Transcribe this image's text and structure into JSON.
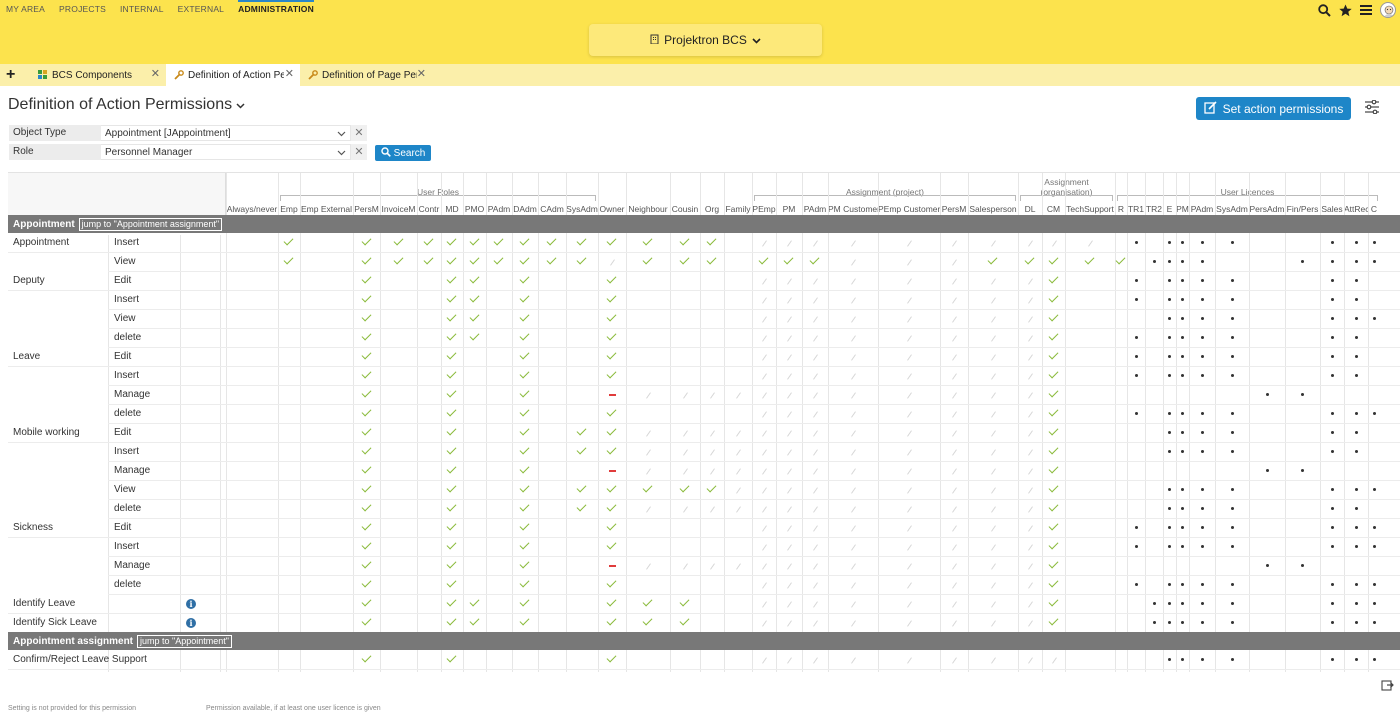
{
  "topnav": [
    {
      "label": "MY AREA",
      "active": false
    },
    {
      "label": "PROJECTS",
      "active": false
    },
    {
      "label": "INTERNAL",
      "active": false
    },
    {
      "label": "EXTERNAL",
      "active": false
    },
    {
      "label": "ADMINISTRATION",
      "active": true
    }
  ],
  "project_selector": {
    "label": "Projektron BCS"
  },
  "tabs": [
    {
      "label": "BCS Components",
      "active": false,
      "icon": "components-icon"
    },
    {
      "label": "Definition of Action Per",
      "active": true,
      "icon": "wrench-icon"
    },
    {
      "label": "Definition of Page Perm",
      "active": false,
      "icon": "wrench-icon"
    }
  ],
  "page": {
    "title": "Definition of Action Permissions"
  },
  "set_button": {
    "label": "Set action permissions"
  },
  "filters": {
    "object_type": {
      "label": "Object Type",
      "value": "Appointment [JAppointment]"
    },
    "role": {
      "label": "Role",
      "value": "Personnel Manager"
    },
    "search_label": "Search"
  },
  "colors": {
    "accent": "#1e86c8",
    "topbar": "#fce34d",
    "tabsbar": "#fbefaa",
    "check": "#8aba3a",
    "deny": "#e03c3c",
    "section": "#787878"
  },
  "grid": {
    "groups": [
      {
        "label": "User Roles",
        "from": 1,
        "to": 12
      },
      {
        "label": "Assignment (project)",
        "from": 16,
        "to": 25
      },
      {
        "label": "Assignment\n(organisation)",
        "from": 26,
        "to": 28
      },
      {
        "label": "User Licences",
        "from": 29,
        "to": 44
      }
    ],
    "columns": [
      "Always/never",
      "Emp",
      "Emp External",
      "PersM",
      "InvoiceM",
      "Contr",
      "MD",
      "PMO",
      "PAdm",
      "DAdm",
      "CAdm",
      "SysAdm",
      "Owner",
      "Neighbour",
      "Cousin",
      "Org",
      "Family",
      "PEmp",
      "PM",
      "PAdm",
      "PM Customer",
      "PEmp Customer",
      "PersM",
      "Salesperson",
      "DL",
      "CM",
      "TechSupport",
      "R",
      "TR1",
      "TR2",
      "E",
      "PM",
      "PAdm",
      "SysAdm",
      "PersAdm",
      "Fin/Pers",
      "Sales",
      "AttRec",
      "C"
    ],
    "sections": [
      {
        "title": "Appointment",
        "jump": "jump to \"Appointment assignment\"",
        "rows": [
          {
            "object": "Appointment",
            "action": "Insert",
            "cells": ".k.kkkkkkkkkkkkk.nnnnnnnnnn.*.****..*****"
          },
          {
            "object": "",
            "action": "View",
            "cells": ".k.kkkkkkkkknkkk.kkknnnkkkkk.****..*****"
          },
          {
            "object": "Deputy",
            "action": "Edit",
            "cells": "...k..kk.k..k....nnnnnnnnk..*.****..**.*."
          },
          {
            "object": "",
            "action": "Insert",
            "cells": "...k..kk.k..k....nnnnnnnnk..*.****..**.*."
          },
          {
            "object": "",
            "action": "View",
            "cells": "...k..kk.k..k....nnnnnnnnk....****..****."
          },
          {
            "object": "",
            "action": "delete",
            "cells": "...k..kk.k..k....nnnnnnnnk..*.****..**.*."
          },
          {
            "object": "Leave",
            "action": "Edit",
            "cells": "...k..k..k..k....nnnnnnnnk..*.****..**.*."
          },
          {
            "object": "",
            "action": "Insert",
            "cells": "...k..k..k..k....nnnnnnnnk..*.****..**.*."
          },
          {
            "object": "",
            "action": "Manage",
            "cells": "...k..k..k..-nnnnnnnnnnnnk........**...."
          },
          {
            "object": "",
            "action": "delete",
            "cells": "...k..k..k..k....nnnnnnnnk..*.****..****."
          },
          {
            "object": "Mobile working",
            "action": "Edit",
            "cells": "...k..k..k.kknnnnnnnnnnnnk....****..**.*."
          },
          {
            "object": "",
            "action": "Insert",
            "cells": "...k..k..k.kknnnnnnnnnnnnk....****..**.*."
          },
          {
            "object": "",
            "action": "Manage",
            "cells": "...k..k..k..-nnnnnnnnnnnnk........**...."
          },
          {
            "object": "",
            "action": "View",
            "cells": "...k..k..k.kkkkknnnnnnnnnk....****..****."
          },
          {
            "object": "",
            "action": "delete",
            "cells": "...k..k..k.kknnnnnnnnnnnnk....****..**.*."
          },
          {
            "object": "Sickness",
            "action": "Edit",
            "cells": "...k..k..k..k....nnnnnnnnk..*.****..****."
          },
          {
            "object": "",
            "action": "Insert",
            "cells": "...k..k..k..k....nnnnnnnnk..*.****..****."
          },
          {
            "object": "",
            "action": "Manage",
            "cells": "...k..k..k..-nnnnnnnnnnnnk........**...."
          },
          {
            "object": "",
            "action": "delete",
            "cells": "...k..k..k..k....nnnnnnnnk..*.****..****."
          },
          {
            "object": "Identify Leave",
            "action": "",
            "info": true,
            "cells": "...k..kk.k..kkk..nnnnnnnnk...*****..****."
          },
          {
            "object": "Identify Sick Leave",
            "action": "",
            "info": true,
            "cells": "...k..kk.k..kkk..nnnnnnnnk...*****..****."
          }
        ]
      },
      {
        "title": "Appointment assignment",
        "jump": "jump to \"Appointment\"",
        "rows": [
          {
            "object": "Confirm/Reject Leave Support",
            "action": "",
            "cells": "...k..k.....k....nnnnnnnnn....****..****."
          }
        ]
      }
    ]
  },
  "legend": [
    "Setting is not provided for this permission",
    "Permission available, if at least one user licence is given"
  ]
}
